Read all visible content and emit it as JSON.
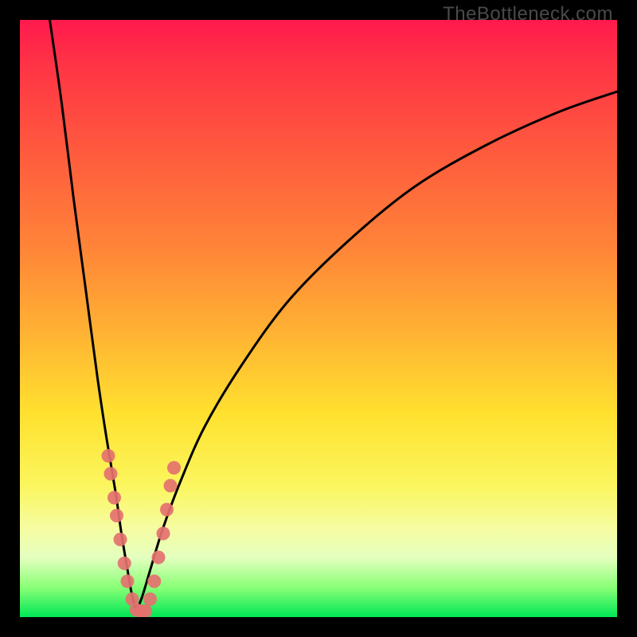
{
  "watermark": "TheBottleneck.com",
  "colors": {
    "gradient_top": "#ff1a4d",
    "gradient_mid_orange": "#ff8438",
    "gradient_mid_yellow": "#ffe12f",
    "gradient_bottom": "#00e756",
    "curve": "#000000",
    "marker_fill": "#e4716f",
    "frame": "#000000"
  },
  "chart_data": {
    "type": "line",
    "title": "",
    "xlabel": "",
    "ylabel": "",
    "xlim": [
      0,
      100
    ],
    "ylim": [
      0,
      100
    ],
    "note": "x and y in percent of plot area; y=0 at bottom. Two branches of a V-shaped bottleneck curve meeting near x≈19, y≈0.",
    "series": [
      {
        "name": "left-branch",
        "x": [
          5.0,
          7.0,
          9.0,
          11.0,
          13.0,
          14.5,
          16.0,
          17.0,
          18.0,
          18.8,
          19.5
        ],
        "y": [
          100,
          86,
          70,
          55,
          40,
          30,
          21,
          14,
          8,
          3.5,
          1.0
        ]
      },
      {
        "name": "right-branch",
        "x": [
          19.5,
          20.5,
          22.0,
          24.0,
          27.0,
          31.0,
          37.0,
          45.0,
          55.0,
          66.0,
          78.0,
          90.0,
          100.0
        ],
        "y": [
          1.0,
          3.5,
          8.5,
          15.0,
          23.0,
          32.0,
          42.0,
          53.0,
          63.0,
          72.0,
          79.0,
          84.5,
          88.0
        ]
      }
    ],
    "markers": {
      "name": "data-points",
      "note": "salmon dots clustered near the trough on both branches",
      "points": [
        {
          "x": 14.8,
          "y": 27.0
        },
        {
          "x": 15.2,
          "y": 24.0
        },
        {
          "x": 15.8,
          "y": 20.0
        },
        {
          "x": 16.2,
          "y": 17.0
        },
        {
          "x": 16.8,
          "y": 13.0
        },
        {
          "x": 17.5,
          "y": 9.0
        },
        {
          "x": 18.0,
          "y": 6.0
        },
        {
          "x": 18.8,
          "y": 3.0
        },
        {
          "x": 19.5,
          "y": 1.2
        },
        {
          "x": 20.3,
          "y": 1.0
        },
        {
          "x": 21.0,
          "y": 1.0
        },
        {
          "x": 21.8,
          "y": 3.0
        },
        {
          "x": 22.5,
          "y": 6.0
        },
        {
          "x": 23.2,
          "y": 10.0
        },
        {
          "x": 24.0,
          "y": 14.0
        },
        {
          "x": 24.6,
          "y": 18.0
        },
        {
          "x": 25.2,
          "y": 22.0
        },
        {
          "x": 25.8,
          "y": 25.0
        }
      ]
    }
  }
}
